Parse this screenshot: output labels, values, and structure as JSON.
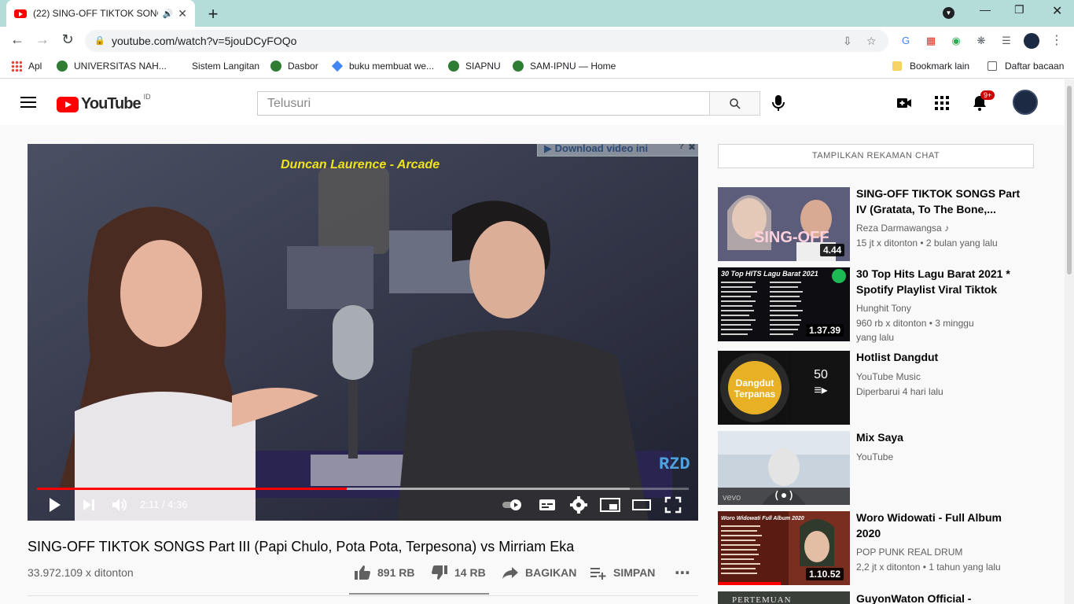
{
  "browser": {
    "tab_title": "(22) SING-OFF TIKTOK SONG",
    "url": "youtube.com/watch?v=5jouDCyFOQo",
    "bookmarks": [
      {
        "label": "Apl"
      },
      {
        "label": "UNIVERSITAS NAH..."
      },
      {
        "label": "Sistem Langitan"
      },
      {
        "label": "Dasbor"
      },
      {
        "label": "buku membuat we..."
      },
      {
        "label": "SIAPNU"
      },
      {
        "label": "SAM-IPNU — Home"
      }
    ],
    "bookmark_other": "Bookmark lain",
    "reading_list": "Daftar bacaan"
  },
  "yt": {
    "logo_text": "YouTube",
    "country_code": "ID",
    "search_placeholder": "Telusuri",
    "notif_count": "9+"
  },
  "player": {
    "overlay_caption": "Duncan Laurence - Arcade",
    "download_label": "Download video ini",
    "watermark": "RZD",
    "time": "2:11 / 4:36",
    "progress_fraction": 0.475,
    "buffered_fraction": 0.91
  },
  "video": {
    "title": "SING-OFF TIKTOK SONGS Part III (Papi Chulo, Pota Pota, Terpesona) vs Mirriam Eka",
    "views": "33.972.109 x ditonton",
    "likes": "891 RB",
    "dislikes": "14 RB",
    "share": "BAGIKAN",
    "save": "SIMPAN"
  },
  "sidebar": {
    "chat_button": "TAMPILKAN REKAMAN CHAT",
    "items": [
      {
        "title": "SING-OFF TIKTOK SONGS Part IV (Gratata, To The Bone,...",
        "channel": "Reza Darmawangsa",
        "meta": "15 jt x ditonton • 2 bulan yang lalu",
        "duration": "4.44",
        "thumb_text": "SING-OFF"
      },
      {
        "title": "30 Top Hits Lagu Barat 2021 * Spotify Playlist Viral Tiktok",
        "channel": "Hunghit Tony",
        "meta": "960 rb x ditonton • 3 minggu yang lalu",
        "duration": "1.37.39",
        "thumb_text": "30 Top HITS Lagu Barat 2021"
      },
      {
        "title": "Hotlist Dangdut",
        "channel": "YouTube Music",
        "meta": "Diperbarui 4 hari lalu",
        "count": "50",
        "thumb_text": "Dangdut Terpanas"
      },
      {
        "title": "Mix Saya",
        "channel": "YouTube",
        "meta": "",
        "thumb_text": "vevo"
      },
      {
        "title": "Woro Widowati - Full Album 2020",
        "channel": "POP PUNK REAL DRUM",
        "meta": "2,2 jt x ditonton • 1 tahun yang lalu",
        "duration": "1.10.52",
        "thumb_text": "Woro Widowati Full Album 2020"
      },
      {
        "title": "GuyonWaton Official -",
        "channel": "",
        "meta": "",
        "thumb_text": "PERTEMUAN"
      }
    ]
  }
}
